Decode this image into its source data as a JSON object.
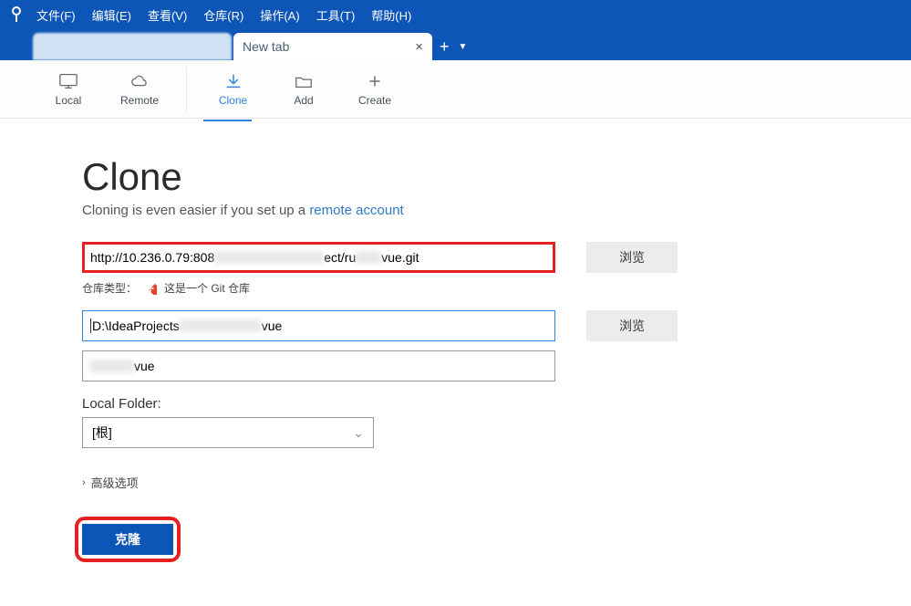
{
  "menu": {
    "file": "文件(F)",
    "edit": "编辑(E)",
    "view": "查看(V)",
    "repo": "仓库(R)",
    "actions": "操作(A)",
    "tools": "工具(T)",
    "help": "帮助(H)"
  },
  "tabs": {
    "inactive": "",
    "active": "New tab"
  },
  "toolbar": {
    "local": "Local",
    "remote": "Remote",
    "clone": "Clone",
    "add": "Add",
    "create": "Create"
  },
  "page": {
    "title": "Clone",
    "subtitle_pre": "Cloning is even easier if you set up a ",
    "subtitle_link": "remote account"
  },
  "form": {
    "source_prefix": "http://10.236.0.79:808",
    "source_mid": "ect/ru",
    "source_suffix": "vue.git",
    "dest_prefix": "D:\\IdeaProjects",
    "dest_suffix": "vue",
    "name_suffix": "vue",
    "browse": "浏览",
    "repo_type_label": "仓库类型：",
    "repo_type_text": "这是一个 Git 仓库",
    "local_folder_label": "Local Folder:",
    "local_folder_value": "[根]",
    "advanced": "高级选项",
    "clone_button": "克隆"
  }
}
